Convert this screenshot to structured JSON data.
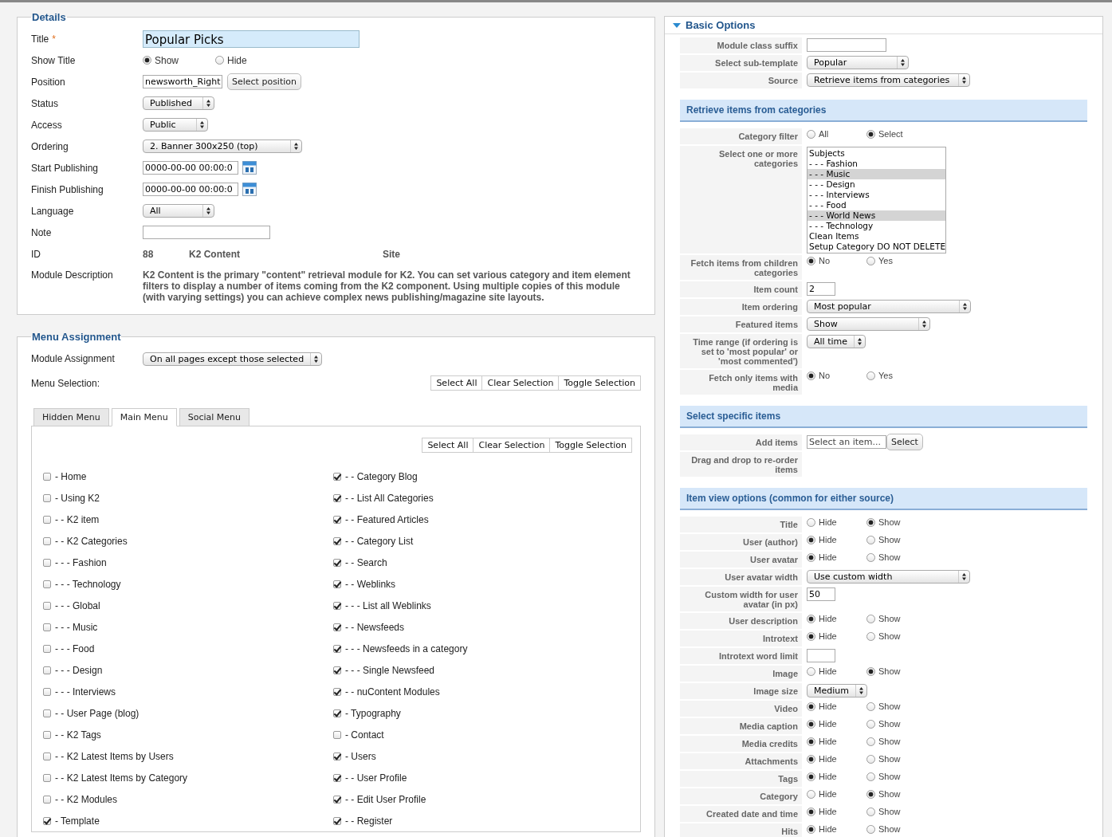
{
  "details": {
    "legend": "Details",
    "fields": [
      {
        "kind": "title",
        "label": "Title",
        "required_mark": "*",
        "value": "Popular Picks"
      },
      {
        "kind": "radio",
        "label": "Show Title",
        "options": [
          {
            "label": "Show",
            "selected": true
          },
          {
            "label": "Hide",
            "selected": false
          }
        ]
      },
      {
        "kind": "picker",
        "label": "Position",
        "value": "newsworth_Right",
        "button": "Select position"
      },
      {
        "kind": "select",
        "label": "Status",
        "value": "Published"
      },
      {
        "kind": "select",
        "label": "Access",
        "value": "Public"
      },
      {
        "kind": "select",
        "label": "Ordering",
        "value": "2. Banner 300x250 (top)"
      },
      {
        "kind": "date",
        "label": "Start Publishing",
        "value": "0000-00-00 00:00:0"
      },
      {
        "kind": "date",
        "label": "Finish Publishing",
        "value": "0000-00-00 00:00:0"
      },
      {
        "kind": "select",
        "label": "Language",
        "value": "All"
      },
      {
        "kind": "input",
        "label": "Note"
      },
      {
        "kind": "info",
        "label": "ID",
        "values": [
          "88",
          "K2 Content",
          "Site"
        ]
      },
      {
        "kind": "description",
        "label": "Module Description",
        "text": "K2 Content is the primary \"content\" retrieval module for K2. You can set various category and item element filters to display a number of items coming from the K2 component. Using multiple copies of this module (with varying settings) you can achieve complex news publishing/magazine site layouts."
      }
    ]
  },
  "menu_assignment": {
    "legend": "Menu Assignment",
    "assignment_label": "Module Assignment",
    "assignment_value": "On all pages except those selected",
    "selection_label": "Menu Selection:",
    "buttons": [
      "Select All",
      "Clear Selection",
      "Toggle Selection"
    ],
    "tabs": [
      {
        "label": "Hidden Menu",
        "selected": false
      },
      {
        "label": "Main Menu",
        "selected": true
      },
      {
        "label": "Social Menu",
        "selected": false
      }
    ],
    "panel_buttons": [
      "Select All",
      "Clear Selection",
      "Toggle Selection"
    ],
    "columns": [
      {
        "items": [
          {
            "label": "- Home",
            "checked": false
          },
          {
            "label": "- Using K2",
            "checked": false
          },
          {
            "label": "- - K2 item",
            "checked": false
          },
          {
            "label": "- - K2 Categories",
            "checked": false
          },
          {
            "label": "- - - Fashion",
            "checked": false
          },
          {
            "label": "- - - Technology",
            "checked": false
          },
          {
            "label": "- - - Global",
            "checked": false
          },
          {
            "label": "- - - Music",
            "checked": false
          },
          {
            "label": "- - - Food",
            "checked": false
          },
          {
            "label": "- - - Design",
            "checked": false
          },
          {
            "label": "- - - Interviews",
            "checked": false
          },
          {
            "label": "- - User Page (blog)",
            "checked": false
          },
          {
            "label": "- - K2 Tags",
            "checked": false
          },
          {
            "label": "- - K2 Latest Items by Users",
            "checked": false
          },
          {
            "label": "- - K2 Latest Items by Category",
            "checked": false
          },
          {
            "label": "- - K2 Modules",
            "checked": false
          },
          {
            "label": "- Template",
            "checked": true
          }
        ]
      },
      {
        "items": [
          {
            "label": "- - Category Blog",
            "checked": true
          },
          {
            "label": "- - List All Categories",
            "checked": true
          },
          {
            "label": "- - Featured Articles",
            "checked": true
          },
          {
            "label": "- - Category List",
            "checked": true
          },
          {
            "label": "- - Search",
            "checked": true
          },
          {
            "label": "- - Weblinks",
            "checked": true
          },
          {
            "label": "- - - List all Weblinks",
            "checked": true
          },
          {
            "label": "- - Newsfeeds",
            "checked": true
          },
          {
            "label": "- - - Newsfeeds in a category",
            "checked": true
          },
          {
            "label": "- - - Single Newsfeed",
            "checked": true
          },
          {
            "label": "- - nuContent Modules",
            "checked": true
          },
          {
            "label": "- Typography",
            "checked": true
          },
          {
            "label": "- Contact",
            "checked": false
          },
          {
            "label": "- Users",
            "checked": true
          },
          {
            "label": "- - User Profile",
            "checked": true
          },
          {
            "label": "- - Edit User Profile",
            "checked": true
          },
          {
            "label": "- - Register",
            "checked": true
          }
        ]
      }
    ]
  },
  "basic_options": {
    "title": "Basic Options",
    "expanded": true,
    "rows": [
      {
        "kind": "input",
        "label": "Module class suffix"
      },
      {
        "kind": "select",
        "label": "Select sub-template",
        "value": "Popular"
      },
      {
        "kind": "select",
        "label": "Source",
        "value": "Retrieve items from categories"
      },
      {
        "kind": "section",
        "label": "Retrieve items from categories"
      },
      {
        "kind": "radio",
        "label": "Category filter",
        "options": [
          {
            "label": "All",
            "selected": false
          },
          {
            "label": "Select",
            "selected": true
          }
        ]
      },
      {
        "kind": "listbox",
        "label": "Select one or more categories",
        "options": [
          {
            "label": "Subjects",
            "selected": false
          },
          {
            "label": "- - - Fashion",
            "selected": false
          },
          {
            "label": "- - - Music",
            "selected": true
          },
          {
            "label": "- - - Design",
            "selected": false
          },
          {
            "label": "- - - Interviews",
            "selected": false
          },
          {
            "label": "- - - Food",
            "selected": false
          },
          {
            "label": "- - - World News",
            "selected": true
          },
          {
            "label": "- - - Technology",
            "selected": false
          },
          {
            "label": "Clean Items",
            "selected": false
          },
          {
            "label": "Setup Category DO NOT DELETE",
            "selected": false
          }
        ]
      },
      {
        "kind": "radio",
        "label": "Fetch items from children categories",
        "options": [
          {
            "label": "No",
            "selected": true
          },
          {
            "label": "Yes",
            "selected": false
          }
        ]
      },
      {
        "kind": "input",
        "label": "Item count",
        "value": "2"
      },
      {
        "kind": "select",
        "label": "Item ordering",
        "value": "Most popular"
      },
      {
        "kind": "select",
        "label": "Featured items",
        "value": "Show"
      },
      {
        "kind": "select",
        "label": "Time range (if ordering is set to 'most popular' or 'most commented')",
        "value": "All time"
      },
      {
        "kind": "radio",
        "label": "Fetch only items with media",
        "options": [
          {
            "label": "No",
            "selected": true
          },
          {
            "label": "Yes",
            "selected": false
          }
        ]
      },
      {
        "kind": "section",
        "label": "Select specific items"
      },
      {
        "kind": "picker",
        "label": "Add items",
        "placeholder": "Select an item...",
        "button": "Select"
      },
      {
        "kind": "empty",
        "label": "Drag and drop to re-order items"
      },
      {
        "kind": "section",
        "label": "Item view options (common for either source)"
      },
      {
        "kind": "radio",
        "label": "Title",
        "options": [
          {
            "label": "Hide",
            "selected": false
          },
          {
            "label": "Show",
            "selected": true
          }
        ]
      },
      {
        "kind": "radio",
        "label": "User (author)",
        "options": [
          {
            "label": "Hide",
            "selected": true
          },
          {
            "label": "Show",
            "selected": false
          }
        ]
      },
      {
        "kind": "radio",
        "label": "User avatar",
        "options": [
          {
            "label": "Hide",
            "selected": true
          },
          {
            "label": "Show",
            "selected": false
          }
        ]
      },
      {
        "kind": "select",
        "label": "User avatar width",
        "value": "Use custom width"
      },
      {
        "kind": "input",
        "label": "Custom width for user avatar (in px)",
        "value": "50"
      },
      {
        "kind": "radio",
        "label": "User description",
        "options": [
          {
            "label": "Hide",
            "selected": true
          },
          {
            "label": "Show",
            "selected": false
          }
        ]
      },
      {
        "kind": "radio",
        "label": "Introtext",
        "options": [
          {
            "label": "Hide",
            "selected": true
          },
          {
            "label": "Show",
            "selected": false
          }
        ]
      },
      {
        "kind": "input",
        "label": "Introtext word limit"
      },
      {
        "kind": "radio",
        "label": "Image",
        "options": [
          {
            "label": "Hide",
            "selected": false
          },
          {
            "label": "Show",
            "selected": true
          }
        ]
      },
      {
        "kind": "select",
        "label": "Image size",
        "value": "Medium"
      },
      {
        "kind": "radio",
        "label": "Video",
        "options": [
          {
            "label": "Hide",
            "selected": true
          },
          {
            "label": "Show",
            "selected": false
          }
        ]
      },
      {
        "kind": "radio",
        "label": "Media caption",
        "options": [
          {
            "label": "Hide",
            "selected": true
          },
          {
            "label": "Show",
            "selected": false
          }
        ]
      },
      {
        "kind": "radio",
        "label": "Media credits",
        "options": [
          {
            "label": "Hide",
            "selected": true
          },
          {
            "label": "Show",
            "selected": false
          }
        ]
      },
      {
        "kind": "radio",
        "label": "Attachments",
        "options": [
          {
            "label": "Hide",
            "selected": true
          },
          {
            "label": "Show",
            "selected": false
          }
        ]
      },
      {
        "kind": "radio",
        "label": "Tags",
        "options": [
          {
            "label": "Hide",
            "selected": true
          },
          {
            "label": "Show",
            "selected": false
          }
        ]
      },
      {
        "kind": "radio",
        "label": "Category",
        "options": [
          {
            "label": "Hide",
            "selected": false
          },
          {
            "label": "Show",
            "selected": true
          }
        ]
      },
      {
        "kind": "radio",
        "label": "Created date and time",
        "options": [
          {
            "label": "Hide",
            "selected": true
          },
          {
            "label": "Show",
            "selected": false
          }
        ]
      },
      {
        "kind": "radio",
        "label": "Hits",
        "options": [
          {
            "label": "Hide",
            "selected": true
          },
          {
            "label": "Show",
            "selected": false
          }
        ]
      }
    ]
  }
}
